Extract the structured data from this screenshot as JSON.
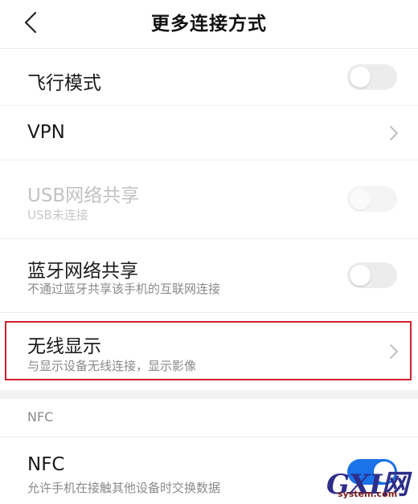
{
  "header": {
    "title": "更多连接方式",
    "back_icon": "chevron-left-icon"
  },
  "rows": {
    "airplane": {
      "title": "飞行模式",
      "toggle_on": false
    },
    "vpn": {
      "title": "VPN",
      "icon": "chevron-right-icon"
    },
    "usb_tethering": {
      "title": "USB网络共享",
      "subtitle": "USB未连接",
      "toggle_on": false,
      "enabled": false
    },
    "bt_tethering": {
      "title": "蓝牙网络共享",
      "subtitle": "不通过蓝牙共享该手机的互联网连接",
      "toggle_on": false
    },
    "wireless_display": {
      "title": "无线显示",
      "subtitle": "与显示设备无线连接，显示影像",
      "icon": "chevron-right-icon"
    }
  },
  "nfc_section": {
    "header": "NFC",
    "row": {
      "title": "NFC",
      "subtitle": "允许手机在接触其他设备时交换数据",
      "toggle_on": true
    }
  },
  "watermark": {
    "letters": "GXI网",
    "domain": "system.com"
  },
  "colors": {
    "highlight": "#d3212d",
    "toggle_on": "#1a73e8",
    "toggle_off": "#ececec"
  }
}
